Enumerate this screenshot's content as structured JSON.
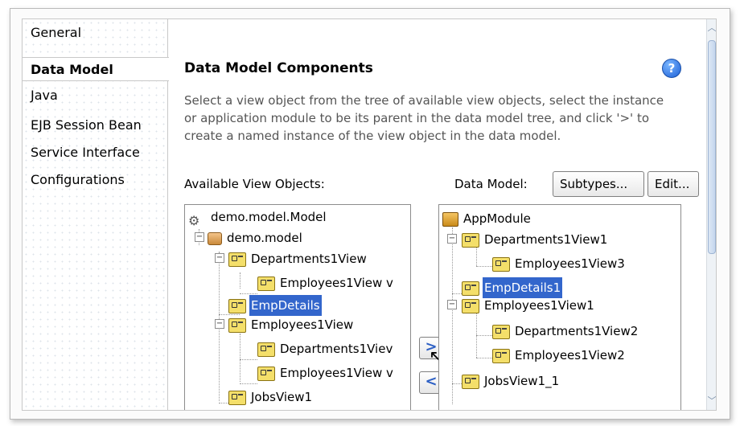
{
  "nav": {
    "items": [
      {
        "label": "General",
        "active": false
      },
      {
        "label": "Data Model",
        "active": true
      },
      {
        "label": "Java",
        "active": false
      },
      {
        "label": "EJB Session Bean",
        "active": false
      },
      {
        "label": "Service Interface",
        "active": false
      },
      {
        "label": "Configurations",
        "active": false
      }
    ]
  },
  "main": {
    "title": "Data Model Components",
    "help": "?",
    "description": "Select a view object from the tree of available view objects, select the instance or application module to be its parent in the data model tree, and click '>' to create a named instance of the view object in the data model."
  },
  "available": {
    "label": "Available View Objects:",
    "nodes": [
      {
        "label": "demo.model.Model",
        "icon": "model-icon"
      },
      {
        "label": "demo.model",
        "icon": "package-icon"
      },
      {
        "label": "Departments1View",
        "icon": "view-object-icon"
      },
      {
        "label": "Employees1View v",
        "icon": "view-object-icon"
      },
      {
        "label": "EmpDetails",
        "icon": "view-object-icon",
        "selected": true
      },
      {
        "label": "Employees1View",
        "icon": "view-object-icon"
      },
      {
        "label": "Departments1Viev",
        "icon": "view-object-icon"
      },
      {
        "label": "Employees1View v",
        "icon": "view-object-icon"
      },
      {
        "label": "JobsView1",
        "icon": "view-object-icon"
      }
    ]
  },
  "datamodel": {
    "label": "Data Model:",
    "subtypes_button": "Subtypes...",
    "edit_button": "Edit...",
    "nodes": [
      {
        "label": "AppModule",
        "icon": "app-module-icon"
      },
      {
        "label": "Departments1View1",
        "icon": "view-instance-icon"
      },
      {
        "label": "Employees1View3",
        "icon": "view-instance-icon"
      },
      {
        "label": "EmpDetails1",
        "icon": "view-instance-icon",
        "selected": true
      },
      {
        "label": "Employees1View1",
        "icon": "view-instance-icon"
      },
      {
        "label": "Departments1View2",
        "icon": "view-instance-icon"
      },
      {
        "label": "Employees1View2",
        "icon": "view-instance-icon"
      },
      {
        "label": "JobsView1_1",
        "icon": "view-instance-icon"
      }
    ]
  },
  "shuttle": {
    "add_label": ">",
    "remove_label": "<"
  }
}
